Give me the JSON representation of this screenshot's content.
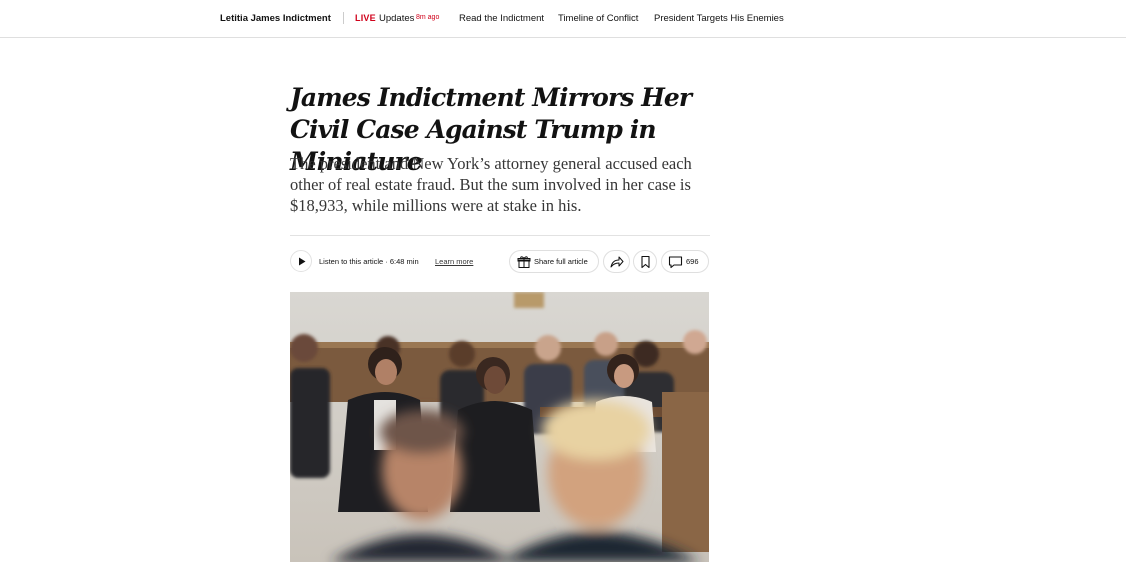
{
  "nav": {
    "brand": "Letitia James Indictment",
    "live_label": "LIVE",
    "updates_label": "Updates",
    "updates_time": "8m ago",
    "links": [
      "Read the Indictment",
      "Timeline of Conflict",
      "President Targets His Enemies"
    ]
  },
  "article": {
    "headline": "James Indictment Mirrors Her Civil Case Against Trump in Miniature",
    "summary": "The president and New York’s attorney general accused each other of real estate fraud. But the sum involved in her case is $18,933, while millions were at stake in his."
  },
  "toolbar": {
    "listen_label": "Listen to this article · 6:48 min",
    "learn_more": "Learn more",
    "share_label": "Share full article",
    "comment_count": "696",
    "icons": [
      "play-icon",
      "gift-icon",
      "share-arrow-icon",
      "bookmark-icon",
      "comment-icon"
    ]
  },
  "colors": {
    "live_red": "#d0021b",
    "text": "#121212",
    "summary_text": "#363636",
    "rule": "#dfdfdf"
  }
}
